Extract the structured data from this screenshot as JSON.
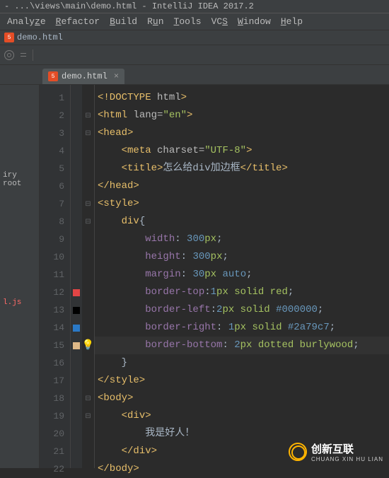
{
  "window": {
    "title": "- ...\\views\\main\\demo.html - IntelliJ IDEA 2017.2"
  },
  "menu": {
    "items": [
      "Analyze",
      "Refactor",
      "Build",
      "Run",
      "Tools",
      "VCS",
      "Window",
      "Help"
    ]
  },
  "breadcrumb": {
    "file": "demo.html"
  },
  "tabs": {
    "active": {
      "name": "demo.html"
    }
  },
  "side": {
    "label1": "iry root",
    "label2": "l.js"
  },
  "gutter": {
    "lines": [
      "1",
      "2",
      "3",
      "4",
      "5",
      "6",
      "7",
      "8",
      "9",
      "10",
      "11",
      "12",
      "13",
      "14",
      "15",
      "16",
      "17",
      "18",
      "19",
      "20",
      "21",
      "22"
    ],
    "markers": {
      "12": "red",
      "13": "black",
      "14": "blue",
      "15": "wheat"
    }
  },
  "code": {
    "l1_a": "<!DOCTYPE ",
    "l1_b": "html",
    "l1_c": ">",
    "l2_a": "<html ",
    "l2_b": "lang=",
    "l2_c": "\"en\"",
    "l2_d": ">",
    "l3": "<head>",
    "l4_a": "<meta ",
    "l4_b": "charset=",
    "l4_c": "\"UTF-8\"",
    "l4_d": ">",
    "l5_a": "<title>",
    "l5_b": "怎么给div加边框",
    "l5_c": "</title>",
    "l6": "</head>",
    "l7": "<style>",
    "l8_a": "div",
    "l8_b": "{",
    "l9_a": "width",
    "l9_b": ": ",
    "l9_c": "300",
    "l9_d": "px",
    "l9_e": ";",
    "l10_a": "height",
    "l10_b": ": ",
    "l10_c": "300",
    "l10_d": "px",
    "l10_e": ";",
    "l11_a": "margin",
    "l11_b": ": ",
    "l11_c": "30",
    "l11_d": "px ",
    "l11_e": "auto",
    "l11_f": ";",
    "l12_a": "border-top",
    "l12_b": ":",
    "l12_c": "1",
    "l12_d": "px ",
    "l12_e": "solid red",
    "l12_f": ";",
    "l13_a": "border-left",
    "l13_b": ":",
    "l13_c": "2",
    "l13_d": "px ",
    "l13_e": "solid ",
    "l13_f": "#000000",
    "l13_g": ";",
    "l14_a": "border-right",
    "l14_b": ": ",
    "l14_c": "1",
    "l14_d": "px ",
    "l14_e": "solid ",
    "l14_f": "#2a79c7",
    "l14_g": ";",
    "l15_a": "border-bottom",
    "l15_b": ": ",
    "l15_c": "2",
    "l15_d": "px ",
    "l15_e": "dotted burlywood",
    "l15_f": ";",
    "l16": "}",
    "l17": "</style>",
    "l18": "<body>",
    "l19": "<div>",
    "l20": "我是好人！",
    "l21": "</div>",
    "l22": "</body>"
  },
  "watermark": {
    "main": "创新互联",
    "sub": "CHUANG XIN HU LIAN"
  }
}
